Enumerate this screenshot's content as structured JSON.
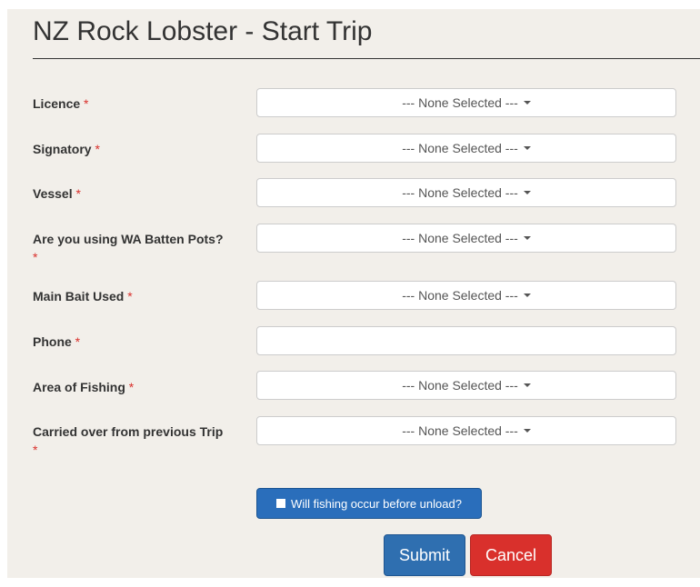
{
  "page": {
    "title": "NZ Rock Lobster - Start Trip"
  },
  "form": {
    "required_marker": "*",
    "licence": {
      "label": "Licence",
      "value": "--- None Selected ---"
    },
    "signatory": {
      "label": "Signatory",
      "value": "--- None Selected ---"
    },
    "vessel": {
      "label": "Vessel",
      "value": "--- None Selected ---"
    },
    "batten_pots": {
      "label": "Are you using WA Batten Pots?",
      "value": "--- None Selected ---"
    },
    "main_bait": {
      "label": "Main Bait Used",
      "value": "--- None Selected ---"
    },
    "phone": {
      "label": "Phone",
      "value": ""
    },
    "area": {
      "label": "Area of Fishing",
      "value": "--- None Selected ---"
    },
    "carried_over": {
      "label": "Carried over from previous Trip",
      "value": "--- None Selected ---"
    }
  },
  "actions": {
    "fishing_before_unload": {
      "label": "Will fishing occur before unload?",
      "checked": false
    },
    "submit_label": "Submit",
    "cancel_label": "Cancel"
  },
  "colors": {
    "panel_background": "#f2efea",
    "required": "#d9302c",
    "primary": "#2f6fb0",
    "danger": "#d9302c"
  }
}
